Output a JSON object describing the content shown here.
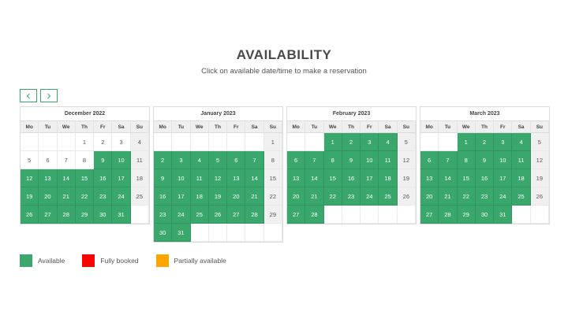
{
  "header": {
    "title": "AVAILABILITY",
    "subtitle": "Click on available date/time to make a reservation"
  },
  "nav": {
    "prev_icon": "chevron-left-icon",
    "next_icon": "chevron-right-icon"
  },
  "colors": {
    "available": "#3aa76d",
    "fully_booked": "#ff0000",
    "partially_available": "#ffa500",
    "sunday_bg": "#f0f0f0"
  },
  "weekdays": [
    "Mo",
    "Tu",
    "We",
    "Th",
    "Fr",
    "Sa",
    "Su"
  ],
  "months": [
    {
      "name": "December 2022",
      "weeks": [
        [
          null,
          null,
          null,
          {
            "d": "1",
            "s": "past"
          },
          {
            "d": "2",
            "s": "past"
          },
          {
            "d": "3",
            "s": "past"
          },
          {
            "d": "4",
            "s": "sun"
          }
        ],
        [
          {
            "d": "5",
            "s": "past"
          },
          {
            "d": "6",
            "s": "past"
          },
          {
            "d": "7",
            "s": "past"
          },
          {
            "d": "8",
            "s": "past"
          },
          {
            "d": "9",
            "s": "avail"
          },
          {
            "d": "10",
            "s": "avail"
          },
          {
            "d": "11",
            "s": "sun"
          }
        ],
        [
          {
            "d": "12",
            "s": "avail"
          },
          {
            "d": "13",
            "s": "avail"
          },
          {
            "d": "14",
            "s": "avail"
          },
          {
            "d": "15",
            "s": "avail"
          },
          {
            "d": "16",
            "s": "avail"
          },
          {
            "d": "17",
            "s": "avail"
          },
          {
            "d": "18",
            "s": "sun"
          }
        ],
        [
          {
            "d": "19",
            "s": "avail"
          },
          {
            "d": "20",
            "s": "avail"
          },
          {
            "d": "21",
            "s": "avail"
          },
          {
            "d": "22",
            "s": "avail"
          },
          {
            "d": "23",
            "s": "avail"
          },
          {
            "d": "24",
            "s": "avail"
          },
          {
            "d": "25",
            "s": "sun"
          }
        ],
        [
          {
            "d": "26",
            "s": "avail"
          },
          {
            "d": "27",
            "s": "avail"
          },
          {
            "d": "28",
            "s": "avail"
          },
          {
            "d": "29",
            "s": "avail"
          },
          {
            "d": "30",
            "s": "avail"
          },
          {
            "d": "31",
            "s": "avail"
          },
          null
        ]
      ]
    },
    {
      "name": "January 2023",
      "weeks": [
        [
          null,
          null,
          null,
          null,
          null,
          null,
          {
            "d": "1",
            "s": "sun"
          }
        ],
        [
          {
            "d": "2",
            "s": "avail"
          },
          {
            "d": "3",
            "s": "avail"
          },
          {
            "d": "4",
            "s": "avail"
          },
          {
            "d": "5",
            "s": "avail"
          },
          {
            "d": "6",
            "s": "avail"
          },
          {
            "d": "7",
            "s": "avail"
          },
          {
            "d": "8",
            "s": "sun"
          }
        ],
        [
          {
            "d": "9",
            "s": "avail"
          },
          {
            "d": "10",
            "s": "avail"
          },
          {
            "d": "11",
            "s": "avail"
          },
          {
            "d": "12",
            "s": "avail"
          },
          {
            "d": "13",
            "s": "avail"
          },
          {
            "d": "14",
            "s": "avail"
          },
          {
            "d": "15",
            "s": "sun"
          }
        ],
        [
          {
            "d": "16",
            "s": "avail"
          },
          {
            "d": "17",
            "s": "avail"
          },
          {
            "d": "18",
            "s": "avail"
          },
          {
            "d": "19",
            "s": "avail"
          },
          {
            "d": "20",
            "s": "avail"
          },
          {
            "d": "21",
            "s": "avail"
          },
          {
            "d": "22",
            "s": "sun"
          }
        ],
        [
          {
            "d": "23",
            "s": "avail"
          },
          {
            "d": "24",
            "s": "avail"
          },
          {
            "d": "25",
            "s": "avail"
          },
          {
            "d": "26",
            "s": "avail"
          },
          {
            "d": "27",
            "s": "avail"
          },
          {
            "d": "28",
            "s": "avail"
          },
          {
            "d": "29",
            "s": "sun"
          }
        ],
        [
          {
            "d": "30",
            "s": "avail"
          },
          {
            "d": "31",
            "s": "avail"
          },
          null,
          null,
          null,
          null,
          null
        ]
      ]
    },
    {
      "name": "February 2023",
      "weeks": [
        [
          null,
          null,
          {
            "d": "1",
            "s": "avail"
          },
          {
            "d": "2",
            "s": "avail"
          },
          {
            "d": "3",
            "s": "avail"
          },
          {
            "d": "4",
            "s": "avail"
          },
          {
            "d": "5",
            "s": "sun"
          }
        ],
        [
          {
            "d": "6",
            "s": "avail"
          },
          {
            "d": "7",
            "s": "avail"
          },
          {
            "d": "8",
            "s": "avail"
          },
          {
            "d": "9",
            "s": "avail"
          },
          {
            "d": "10",
            "s": "avail"
          },
          {
            "d": "11",
            "s": "avail"
          },
          {
            "d": "12",
            "s": "sun"
          }
        ],
        [
          {
            "d": "13",
            "s": "avail"
          },
          {
            "d": "14",
            "s": "avail"
          },
          {
            "d": "15",
            "s": "avail"
          },
          {
            "d": "16",
            "s": "avail"
          },
          {
            "d": "17",
            "s": "avail"
          },
          {
            "d": "18",
            "s": "avail"
          },
          {
            "d": "19",
            "s": "sun"
          }
        ],
        [
          {
            "d": "20",
            "s": "avail"
          },
          {
            "d": "21",
            "s": "avail"
          },
          {
            "d": "22",
            "s": "avail"
          },
          {
            "d": "23",
            "s": "avail"
          },
          {
            "d": "24",
            "s": "avail"
          },
          {
            "d": "25",
            "s": "avail"
          },
          {
            "d": "26",
            "s": "sun"
          }
        ],
        [
          {
            "d": "27",
            "s": "avail"
          },
          {
            "d": "28",
            "s": "avail"
          },
          null,
          null,
          null,
          null,
          null
        ]
      ]
    },
    {
      "name": "March 2023",
      "weeks": [
        [
          null,
          null,
          {
            "d": "1",
            "s": "avail"
          },
          {
            "d": "2",
            "s": "avail"
          },
          {
            "d": "3",
            "s": "avail"
          },
          {
            "d": "4",
            "s": "avail"
          },
          {
            "d": "5",
            "s": "sun"
          }
        ],
        [
          {
            "d": "6",
            "s": "avail"
          },
          {
            "d": "7",
            "s": "avail"
          },
          {
            "d": "8",
            "s": "avail"
          },
          {
            "d": "9",
            "s": "avail"
          },
          {
            "d": "10",
            "s": "avail"
          },
          {
            "d": "11",
            "s": "avail"
          },
          {
            "d": "12",
            "s": "sun"
          }
        ],
        [
          {
            "d": "13",
            "s": "avail"
          },
          {
            "d": "14",
            "s": "avail"
          },
          {
            "d": "15",
            "s": "avail"
          },
          {
            "d": "16",
            "s": "avail"
          },
          {
            "d": "17",
            "s": "avail"
          },
          {
            "d": "18",
            "s": "avail"
          },
          {
            "d": "19",
            "s": "sun"
          }
        ],
        [
          {
            "d": "20",
            "s": "avail"
          },
          {
            "d": "21",
            "s": "avail"
          },
          {
            "d": "22",
            "s": "avail"
          },
          {
            "d": "23",
            "s": "avail"
          },
          {
            "d": "24",
            "s": "avail"
          },
          {
            "d": "25",
            "s": "avail"
          },
          {
            "d": "26",
            "s": "sun"
          }
        ],
        [
          {
            "d": "27",
            "s": "avail"
          },
          {
            "d": "28",
            "s": "avail"
          },
          {
            "d": "29",
            "s": "avail"
          },
          {
            "d": "30",
            "s": "avail"
          },
          {
            "d": "31",
            "s": "avail"
          },
          null,
          null
        ]
      ]
    }
  ],
  "legend": [
    {
      "label": "Available",
      "color": "#3aa76d"
    },
    {
      "label": "Fully booked",
      "color": "#ff0000"
    },
    {
      "label": "Partially available",
      "color": "#ffa500"
    }
  ]
}
